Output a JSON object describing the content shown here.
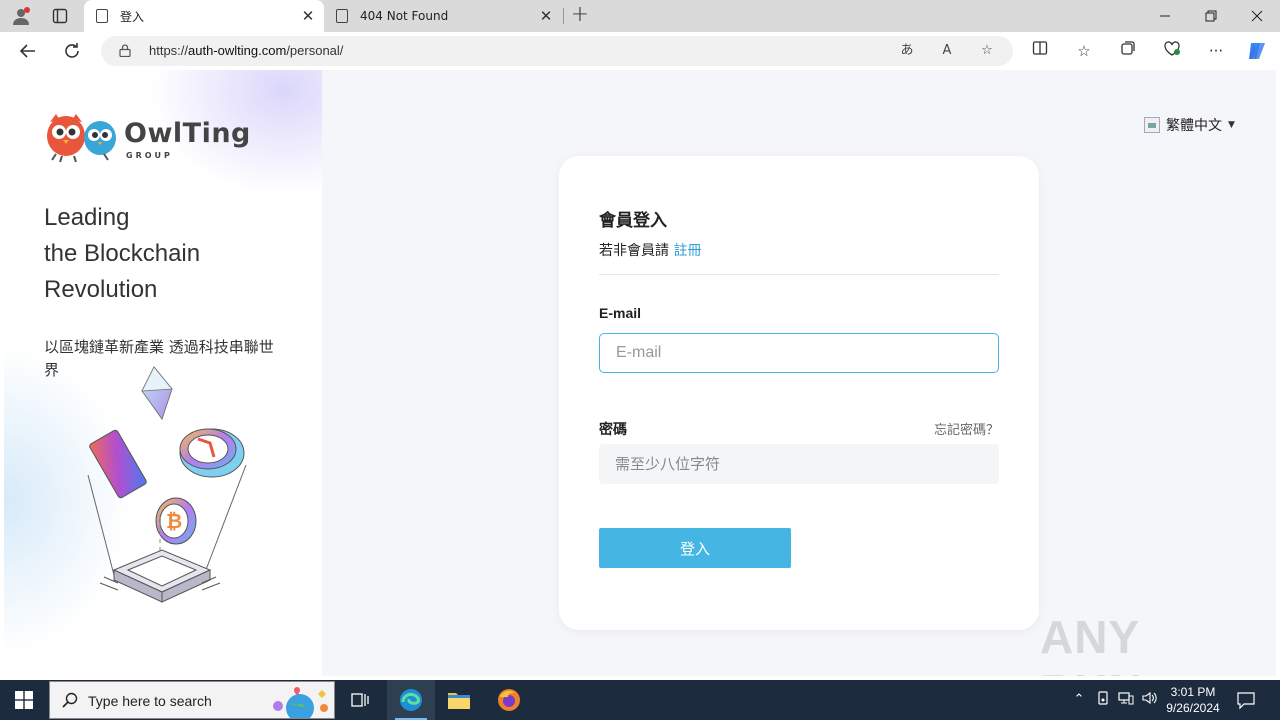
{
  "browser": {
    "tabs": [
      {
        "title": "登入",
        "active": true
      },
      {
        "title": "404 Not Found",
        "active": false
      }
    ],
    "url_prefix": "https://",
    "url_host": "auth-owlting.com",
    "url_path": "/personal/"
  },
  "page": {
    "brand": {
      "word": "OwlTing",
      "group": "GROUP"
    },
    "slogan": [
      "Leading",
      "the Blockchain",
      "Revolution"
    ],
    "slogan_sub": "以區塊鏈革新產業 透過科技串聯世界",
    "language": "繁體中文",
    "login": {
      "title": "會員登入",
      "not_member": "若非會員請",
      "register": "註冊",
      "email_label": "E-mail",
      "email_placeholder": "E-mail",
      "password_label": "密碼",
      "forgot": "忘記密碼？",
      "password_placeholder": "需至少八位字符",
      "submit": "登入"
    },
    "watermark": "ANY RUN"
  },
  "taskbar": {
    "search_placeholder": "Type here to search",
    "time": "3:01 PM",
    "date": "9/26/2024"
  },
  "colors": {
    "accent": "#45b6e4",
    "link": "#2f9fd6",
    "taskbar": "#1c2b3d"
  }
}
